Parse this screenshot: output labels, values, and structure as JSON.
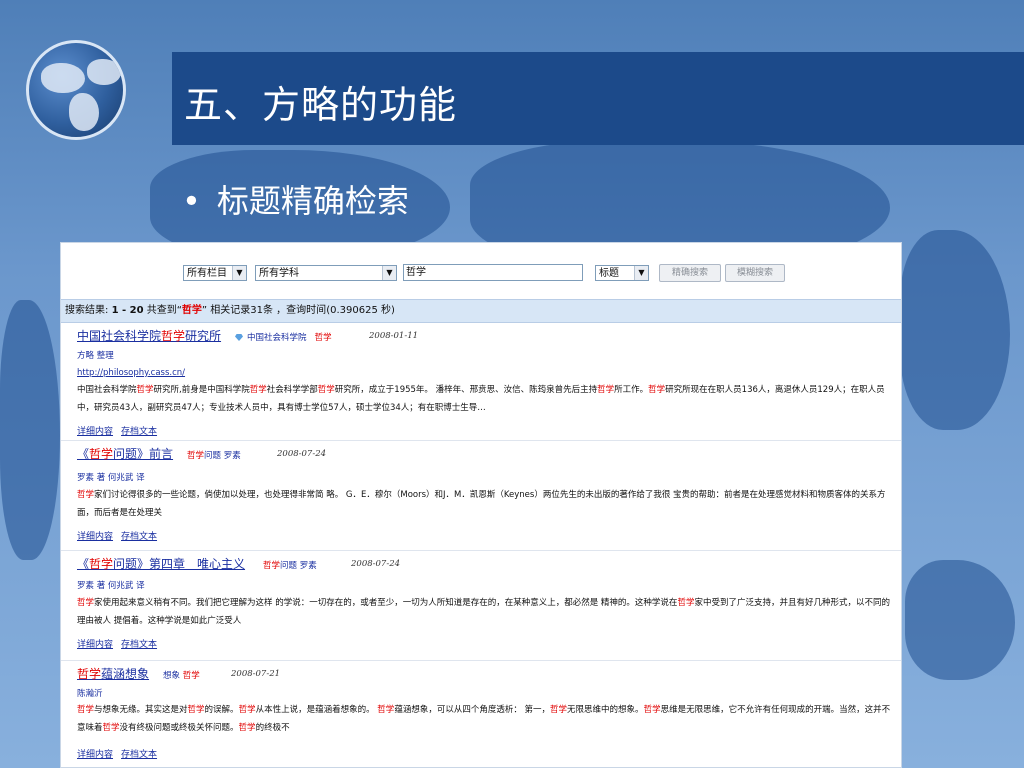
{
  "slide": {
    "title": "五、方略的功能",
    "bullet": "标题精确检索"
  },
  "search": {
    "column_select": "所有栏目",
    "subject_select": "所有学科",
    "query": "哲学",
    "field_select": "标题",
    "exact_button": "精确搜索",
    "fuzzy_button": "模糊搜索"
  },
  "summary": {
    "prefix": "搜索结果: ",
    "range": "1 - 20",
    "found": " 共查到“",
    "term": "哲学",
    "records": "” 相关记录31条 ，查询时间",
    "time": "(0.390625 秒)"
  },
  "results": [
    {
      "title_a": "中国社会科学院",
      "title_hl": "哲学",
      "title_b": "研究所",
      "meta_a": "中国社会科学院",
      "meta_hl": "哲学",
      "date": "2008-01-11",
      "authors": "方略 整理",
      "url": "http://philosophy.cass.cn/",
      "abstract": [
        {
          "t": "中国社会科学院"
        },
        {
          "h": "哲学"
        },
        {
          "t": "研究所,前身是中国科学院"
        },
        {
          "h": "哲学"
        },
        {
          "t": "社会科学学部"
        },
        {
          "h": "哲学"
        },
        {
          "t": "研究所，成立于1955年。 潘梓年、邢贲思、汝信、陈筠泉曾先后主持"
        },
        {
          "h": "哲学"
        },
        {
          "t": "所工作。"
        },
        {
          "h": "哲学"
        },
        {
          "t": "研究所现在在职人员136人，离退休人员129人；在职人员中，研究员43人，副研究员47人；专业技术人员中，具有博士学位57人，硕士学位34人；有在职博士生导…"
        }
      ],
      "link1": "详细内容",
      "link2": "存档文本"
    },
    {
      "title_a": "《",
      "title_hl": "哲学",
      "title_b": "问题》前言",
      "meta_a": "",
      "meta_hl": "哲学",
      "meta_b": "问题 罗素",
      "date": "2008-07-24",
      "authors": "罗素 著 何兆武 译",
      "abstract": [
        {
          "h": "哲学"
        },
        {
          "t": "家们讨论得很多的一些论题，倘使加以处理，也处理得非常简 略。 G．E．穆尔（Moors）和J．M．凯恩斯（Keynes）两位先生的未出版的著作给了我很 宝贵的帮助：前者是在处理感觉材料和物质客体的关系方面，而后者是在处理关"
        }
      ],
      "link1": "详细内容",
      "link2": "存档文本"
    },
    {
      "title_a": "《",
      "title_hl": "哲学",
      "title_b": "问题》第四章　唯心主义",
      "meta_a": "",
      "meta_hl": "哲学",
      "meta_b": "问题 罗素",
      "date": "2008-07-24",
      "authors": "罗素 著 何兆武 译",
      "abstract": [
        {
          "h": "哲学"
        },
        {
          "t": "家使用起来意义稍有不同。我们把它理解为这样 的学说：一切存在的，或者至少，一切为人所知道是存在的，在某种意义上，都必然是 精神的。这种学说在"
        },
        {
          "h": "哲学"
        },
        {
          "t": "家中受到了广泛支持，并且有好几种形式，以不同的理由被人 提倡着。这种学说是如此广泛受人"
        }
      ],
      "link1": "详细内容",
      "link2": "存档文本"
    },
    {
      "title_a": "",
      "title_hl": "哲学",
      "title_b": "蕴涵想象",
      "meta_a": "想象 ",
      "meta_hl": "哲学",
      "date": "2008-07-21",
      "authors": "陈瀚沂",
      "abstract": [
        {
          "h": "哲学"
        },
        {
          "t": "与想象无缘。其实这是对"
        },
        {
          "h": "哲学"
        },
        {
          "t": "的误解。"
        },
        {
          "h": "哲学"
        },
        {
          "t": "从本性上说，是蕴涵着想象的。 "
        },
        {
          "h": "哲学"
        },
        {
          "t": "蕴涵想象，可以从四个角度透析： 第一，"
        },
        {
          "h": "哲学"
        },
        {
          "t": "无限思维中的想象。"
        },
        {
          "h": "哲学"
        },
        {
          "t": "思维是无限思维，它不允许有任何现成的开端。当然，这并不意味着"
        },
        {
          "h": "哲学"
        },
        {
          "t": "没有终极问题或终极关怀问题。"
        },
        {
          "h": "哲学"
        },
        {
          "t": "的终极不"
        }
      ],
      "link1": "详细内容",
      "link2": "存档文本"
    }
  ]
}
